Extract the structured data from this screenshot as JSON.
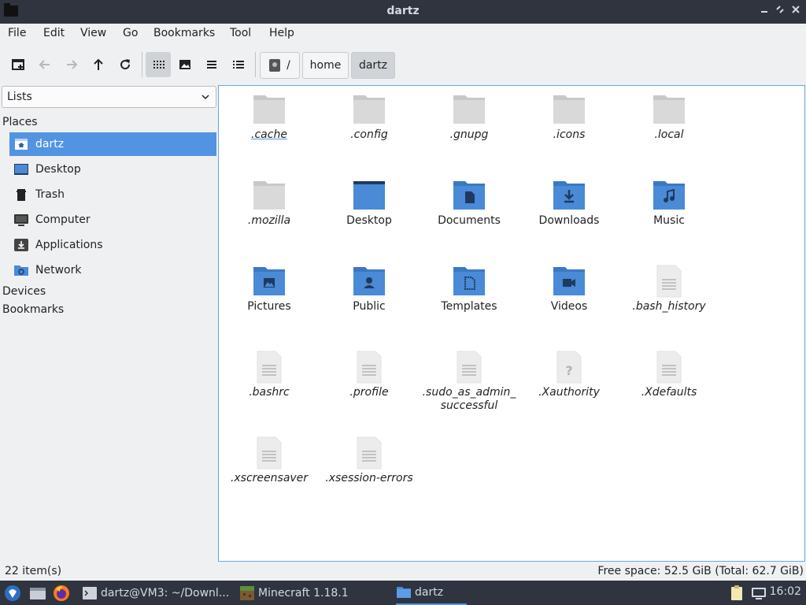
{
  "window": {
    "title": "dartz"
  },
  "menu": [
    "File",
    "Edit",
    "View",
    "Go",
    "Bookmarks",
    "Tool",
    "Help"
  ],
  "toolbar": {
    "buttons": [
      "new-tab-icon",
      "back-arrow-icon",
      "forward-arrow-icon",
      "up-arrow-icon",
      "reload-icon",
      "icon-view-icon",
      "thumbnail-view-icon",
      "compact-view-icon",
      "detailed-list-view-icon"
    ],
    "breadcrumbs": {
      "root": "/",
      "home": "home",
      "current": "dartz"
    }
  },
  "sidebar": {
    "select_value": "Lists",
    "places_header": "Places",
    "places": [
      {
        "label": "dartz",
        "icon": "home-folder-icon"
      },
      {
        "label": "Desktop",
        "icon": "desktop-icon"
      },
      {
        "label": "Trash",
        "icon": "trash-icon"
      },
      {
        "label": "Computer",
        "icon": "computer-icon"
      },
      {
        "label": "Applications",
        "icon": "applications-icon"
      },
      {
        "label": "Network",
        "icon": "network-icon"
      }
    ],
    "devices_header": "Devices",
    "bookmarks_header": "Bookmarks"
  },
  "files": [
    {
      "name": ".cache",
      "type": "folder-gray"
    },
    {
      "name": ".config",
      "type": "folder-gray"
    },
    {
      "name": ".gnupg",
      "type": "folder-gray"
    },
    {
      "name": ".icons",
      "type": "folder-gray"
    },
    {
      "name": ".local",
      "type": "folder-gray"
    },
    {
      "name": ".mozilla",
      "type": "folder-gray"
    },
    {
      "name": "Desktop",
      "type": "folder-desktop"
    },
    {
      "name": "Documents",
      "type": "folder-documents"
    },
    {
      "name": "Downloads",
      "type": "folder-downloads"
    },
    {
      "name": "Music",
      "type": "folder-music"
    },
    {
      "name": "Pictures",
      "type": "folder-pictures"
    },
    {
      "name": "Public",
      "type": "folder-public"
    },
    {
      "name": "Templates",
      "type": "folder-templates"
    },
    {
      "name": "Videos",
      "type": "folder-videos"
    },
    {
      "name": ".bash_history",
      "type": "text-file"
    },
    {
      "name": ".bashrc",
      "type": "text-file"
    },
    {
      "name": ".profile",
      "type": "text-file"
    },
    {
      "name": ".sudo_as_admin_\nsuccessful",
      "type": "text-file"
    },
    {
      "name": ".Xauthority",
      "type": "unknown-file"
    },
    {
      "name": ".Xdefaults",
      "type": "text-file"
    },
    {
      "name": ".xscreensaver",
      "type": "text-file"
    },
    {
      "name": ".xsession-errors",
      "type": "text-file"
    }
  ],
  "status": {
    "items": "22 item(s)",
    "free_space": "Free space: 52.5 GiB (Total: 62.7 GiB)"
  },
  "taskbar": {
    "tasks": [
      {
        "label": "dartz@VM3: ~/Downl...",
        "icon": "terminal-icon"
      },
      {
        "label": "Minecraft 1.18.1",
        "icon": "minecraft-icon"
      },
      {
        "label": "dartz",
        "icon": "folder-icon"
      }
    ],
    "clock": "16:02"
  },
  "colors": {
    "accent": "#5294e2",
    "titlebar": "#2f343f",
    "folder_blue": "#4a8ad6",
    "folder_gray": "#c8c8c8"
  }
}
